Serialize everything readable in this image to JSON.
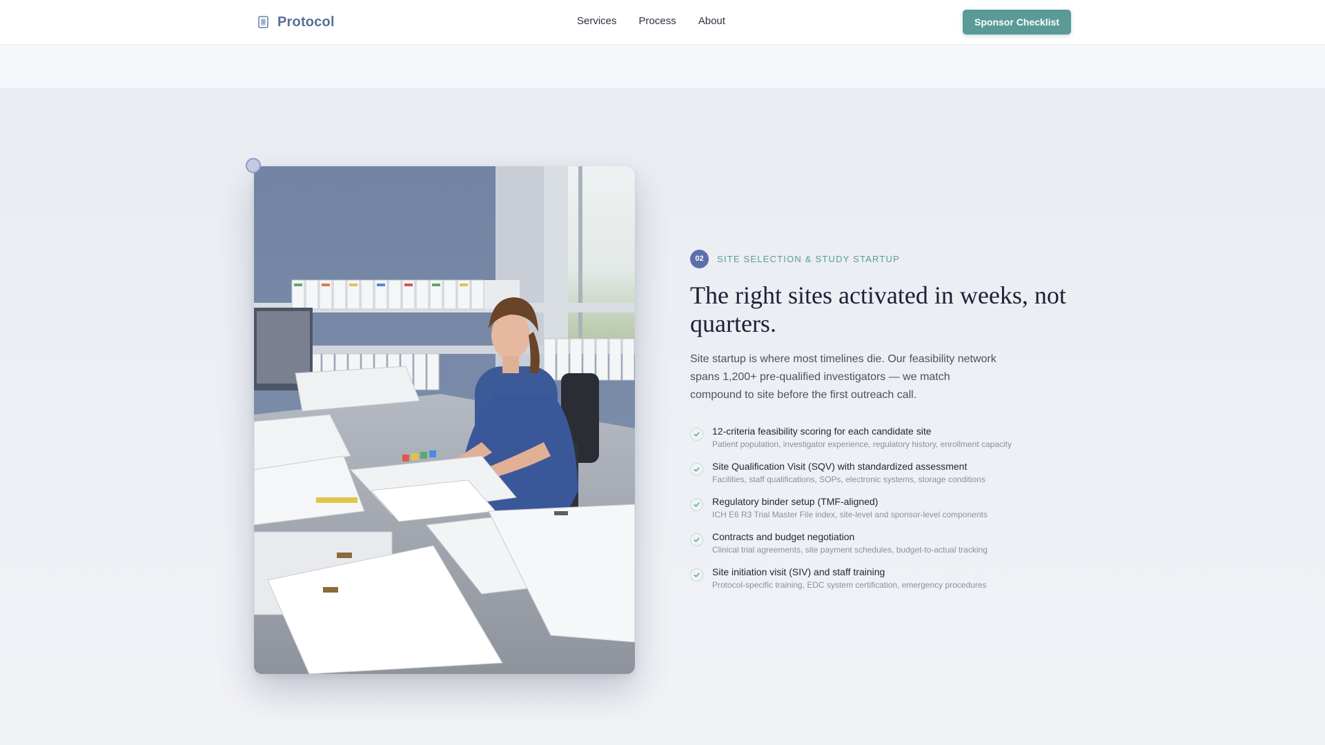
{
  "header": {
    "logo_text": "Protocol",
    "logo_icon": "document-stack-icon",
    "nav": [
      {
        "label": "Services"
      },
      {
        "label": "Process"
      },
      {
        "label": "About"
      }
    ],
    "cta_label": "Sponsor Checklist"
  },
  "colors": {
    "brand": "#5a6d96",
    "accent": "#5a9a97",
    "badge": "#5b6faa"
  },
  "section": {
    "step_number": "02",
    "eyebrow": "SITE SELECTION & STUDY STARTUP",
    "headline": "The right sites activated in weeks, not quarters.",
    "lede": "Site startup is where most timelines die. Our feasibility network spans 1,200+ pre-qualified investigators — we match compound to site before the first outreach call.",
    "features": [
      {
        "title": "12-criteria feasibility scoring for each candidate site",
        "detail": "Patient population, investigator experience, regulatory history, enrollment capacity"
      },
      {
        "title": "Site Qualification Visit (SQV) with standardized assessment",
        "detail": "Facilities, staff qualifications, SOPs, electronic systems, storage conditions"
      },
      {
        "title": "Regulatory binder setup (TMF-aligned)",
        "detail": "ICH E6 R3 Trial Master File index, site-level and sponsor-level components"
      },
      {
        "title": "Contracts and budget negotiation",
        "detail": "Clinical trial agreements, site payment schedules, budget-to-actual tracking"
      },
      {
        "title": "Site initiation visit (SIV) and staff training",
        "detail": "Protocol-specific training, EDC system certification, emergency procedures"
      }
    ]
  }
}
